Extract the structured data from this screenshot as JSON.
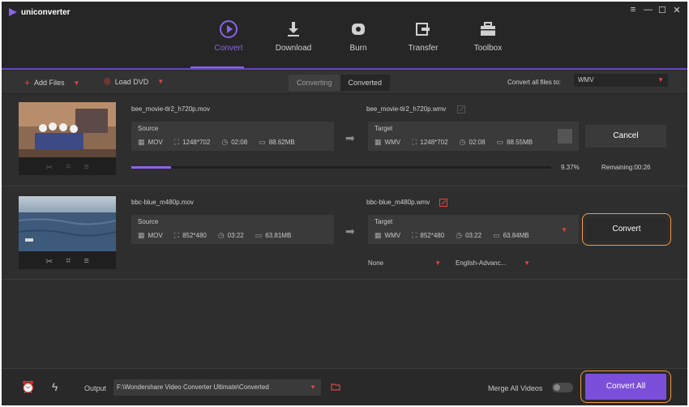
{
  "app": {
    "title": "uniconverter"
  },
  "window_controls": [
    "≡",
    "—",
    "☐",
    "✕"
  ],
  "nav": [
    {
      "label": "Convert",
      "icon": "convert-icon",
      "active": true
    },
    {
      "label": "Download",
      "icon": "download-icon",
      "active": false
    },
    {
      "label": "Burn",
      "icon": "burn-icon",
      "active": false
    },
    {
      "label": "Transfer",
      "icon": "transfer-icon",
      "active": false
    },
    {
      "label": "Toolbox",
      "icon": "toolbox-icon",
      "active": false
    }
  ],
  "toolbar": {
    "add_files": "Add Files",
    "load_dvd": "Load DVD",
    "tabs": {
      "converting": "Converting",
      "converted": "Converted"
    },
    "convert_all_label": "Convert all files to:",
    "format": "WMV"
  },
  "files": [
    {
      "source_name": "bee_movie-tlr2_h720p.mov",
      "target_name": "bee_movie-tlr2_h720p.wmv",
      "source": {
        "title": "Source",
        "format": "MOV",
        "resolution": "1248*702",
        "duration": "02:08",
        "size": "88.62MB"
      },
      "target": {
        "title": "Target",
        "format": "WMV",
        "resolution": "1248*702",
        "duration": "02:08",
        "size": "88.55MB"
      },
      "action": "Cancel",
      "progress_percent": "9.37%",
      "progress_value": 0.0937,
      "remaining": "Remaining:00:26"
    },
    {
      "source_name": "bbc-blue_m480p.mov",
      "target_name": "bbc-blue_m480p.wmv",
      "source": {
        "title": "Source",
        "format": "MOV",
        "resolution": "852*480",
        "duration": "03:22",
        "size": "63.81MB"
      },
      "target": {
        "title": "Target",
        "format": "WMV",
        "resolution": "852*480",
        "duration": "03:22",
        "size": "63.84MB"
      },
      "action": "Convert",
      "subtitle": "None",
      "audio": "English-Advanc..."
    }
  ],
  "bottom": {
    "output_label": "Output",
    "output_path": "F:\\Wondershare Video Converter Ultimate\\Converted",
    "merge_label": "Merge All Videos",
    "convert_all": "Convert All"
  },
  "colors": {
    "accent": "#7b4fd9",
    "highlight": "#f29a46",
    "caret": "#e0463c"
  }
}
